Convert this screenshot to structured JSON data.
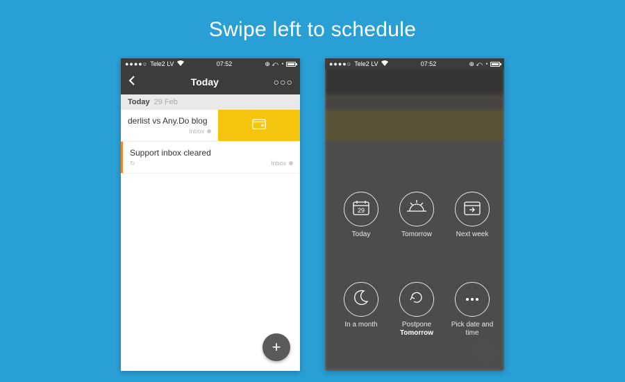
{
  "caption": "Swipe left to schedule",
  "status": {
    "signal": "●●●●○",
    "carrier": "Tele2 LV",
    "wifi": "⎋",
    "time": "07:52",
    "icons": "⊕ ⤺ ◔"
  },
  "navbar": {
    "title": "Today",
    "more": "○○○"
  },
  "section": {
    "title": "Today",
    "date": "29 Feb"
  },
  "tasks": [
    {
      "title": "derlist vs Any.Do blog",
      "folder": "Inbox"
    },
    {
      "title": "Support inbox cleared",
      "folder": "Inbox"
    }
  ],
  "schedule": {
    "items": [
      {
        "label": "Today",
        "sub": "",
        "icon": "cal29"
      },
      {
        "label": "Tomorrow",
        "sub": "",
        "icon": "sunrise"
      },
      {
        "label": "Next week",
        "sub": "",
        "icon": "calnext"
      },
      {
        "label": "In a month",
        "sub": "",
        "icon": "moon"
      },
      {
        "label": "Postpone",
        "sub": "Tomorrow",
        "icon": "cycle"
      },
      {
        "label": "Pick date and time",
        "sub": "",
        "icon": "dots"
      }
    ],
    "cal_day": "29"
  }
}
